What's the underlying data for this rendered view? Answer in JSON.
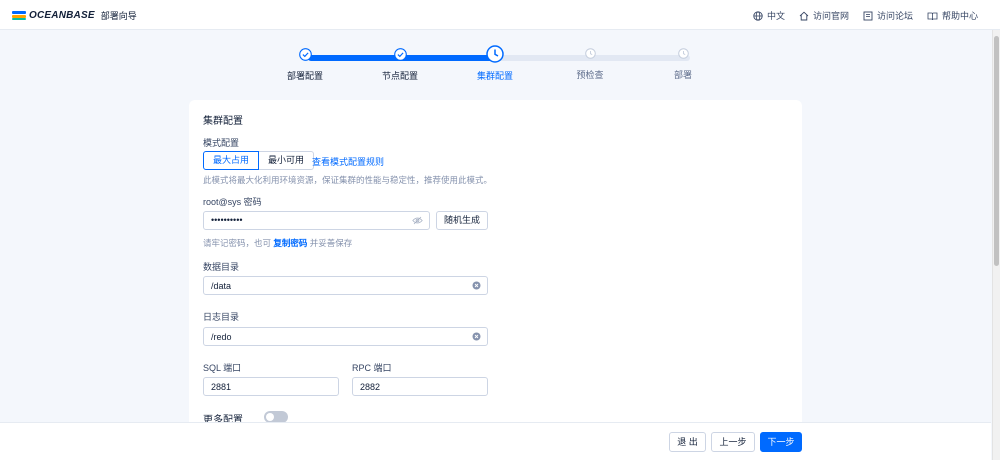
{
  "header": {
    "logo_text": "OCEANBASE",
    "app_name": "部署向导",
    "nav": [
      {
        "label": "中文",
        "icon": "globe-icon"
      },
      {
        "label": "访问官网",
        "icon": "home-icon"
      },
      {
        "label": "访问论坛",
        "icon": "forum-icon"
      },
      {
        "label": "帮助中心",
        "icon": "book-icon"
      }
    ]
  },
  "steps": [
    {
      "label": "部署配置",
      "status": "done"
    },
    {
      "label": "节点配置",
      "status": "done"
    },
    {
      "label": "集群配置",
      "status": "current"
    },
    {
      "label": "预检查",
      "status": "pending"
    },
    {
      "label": "部署",
      "status": "pending"
    }
  ],
  "form": {
    "title": "集群配置",
    "mode": {
      "label": "模式配置",
      "options": [
        "最大占用",
        "最小可用"
      ],
      "selected": "最大占用",
      "rules_link": "查看模式配置规则",
      "hint": "此模式将最大化利用环境资源，保证集群的性能与稳定性，推荐使用此模式。"
    },
    "password": {
      "label": "root@sys 密码",
      "value": "••••••••••",
      "generate_button": "随机生成",
      "hint_prefix": "请牢记密码，也可",
      "hint_link": "复制密码",
      "hint_suffix": "并妥善保存"
    },
    "data_dir": {
      "label": "数据目录",
      "value": "/data"
    },
    "log_dir": {
      "label": "日志目录",
      "value": "/redo"
    },
    "sql_port": {
      "label": "SQL 端口",
      "value": "2881"
    },
    "rpc_port": {
      "label": "RPC 端口",
      "value": "2882"
    },
    "more": {
      "label": "更多配置",
      "enabled": false
    }
  },
  "footer": {
    "exit": "退 出",
    "prev": "上一步",
    "next": "下一步"
  },
  "colors": {
    "primary": "#006aff",
    "done_track": "#006aff",
    "pending_track": "#e2e8f3"
  }
}
